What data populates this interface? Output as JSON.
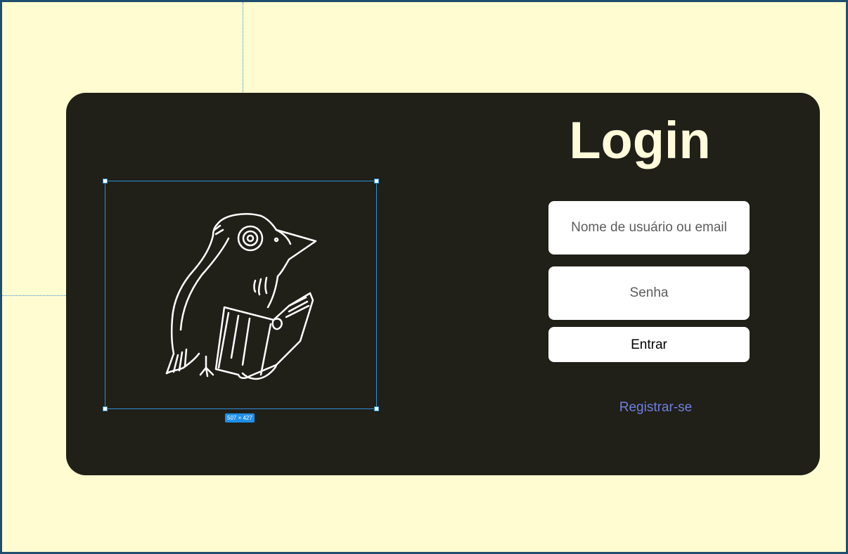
{
  "colors": {
    "canvas_bg": "#fffcd1",
    "card_bg": "#201f18",
    "title_color": "#fffbdb",
    "link_color": "#6f7fe0",
    "selection_color": "#2f8fd8"
  },
  "login": {
    "title": "Login",
    "username_placeholder": "Nome de usuário ou email",
    "password_placeholder": "Senha",
    "submit_label": "Entrar",
    "register_label": "Registrar-se"
  },
  "image": {
    "icon": "crow-reading-book",
    "dimensions_label": "507 × 427"
  }
}
